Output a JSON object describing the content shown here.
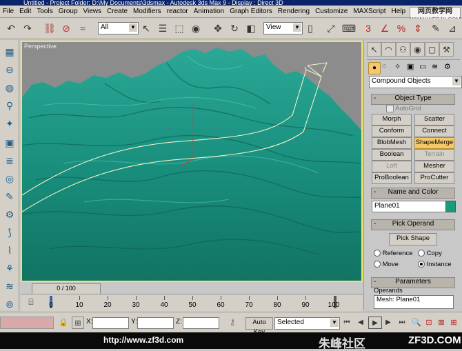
{
  "window": {
    "title": "Untitled - Project Folder: D:\\My Documents\\3dsmax - Autodesk 3ds Max 9 - Display : Direct 3D"
  },
  "menu": [
    "File",
    "Edit",
    "Tools",
    "Group",
    "Views",
    "Create",
    "Modifiers",
    "reactor",
    "Animation",
    "Graph Editors",
    "Rendering",
    "Customize",
    "MAXScript",
    "Help"
  ],
  "watermark_top": {
    "line1": "网页教学网",
    "line2": "WWW.WEBJX.COM"
  },
  "toolbar": {
    "selection_filter": "All",
    "reference_coord": "View"
  },
  "viewport": {
    "label": "Perspective",
    "terrain_color": "#1f8f80",
    "spline_color": "#f2f2c8",
    "border_color": "#f2e64a"
  },
  "timeslider": {
    "label": "0 / 100"
  },
  "trackbar": {
    "ticks": [
      "0",
      "10",
      "20",
      "30",
      "40",
      "50",
      "60",
      "70",
      "80",
      "90",
      "100"
    ]
  },
  "command_panel": {
    "category_dropdown": "Compound Objects",
    "object_type": {
      "title": "Object Type",
      "autogrid": "AutoGrid",
      "buttons": [
        {
          "label": "Morph",
          "state": "normal"
        },
        {
          "label": "Scatter",
          "state": "normal"
        },
        {
          "label": "Conform",
          "state": "normal"
        },
        {
          "label": "Connect",
          "state": "normal"
        },
        {
          "label": "BlobMesh",
          "state": "normal"
        },
        {
          "label": "ShapeMerge",
          "state": "active"
        },
        {
          "label": "Boolean",
          "state": "normal"
        },
        {
          "label": "Terrain",
          "state": "disabled"
        },
        {
          "label": "Loft",
          "state": "disabled"
        },
        {
          "label": "Mesher",
          "state": "normal"
        },
        {
          "label": "ProBoolean",
          "state": "normal"
        },
        {
          "label": "ProCutter",
          "state": "normal"
        }
      ]
    },
    "name_and_color": {
      "title": "Name and Color",
      "name": "Plane01",
      "swatch": "#1a9b7e"
    },
    "pick_operand": {
      "title": "Pick Operand",
      "button": "Pick Shape",
      "reference": "Reference",
      "copy": "Copy",
      "move": "Move",
      "instance": "Instance"
    },
    "parameters": {
      "title": "Parameters",
      "operands_label": "Operands",
      "operand_item": "Mesh: Plane01"
    }
  },
  "status": {
    "x_label": "X:",
    "y_label": "Y:",
    "z_label": "Z:",
    "autokey": "Auto Key",
    "selected": "Selected"
  },
  "footer": {
    "url": "http://www.zf3d.com",
    "brand_cn": "朱峰社区",
    "brand_en": "ZF3D.COM"
  }
}
